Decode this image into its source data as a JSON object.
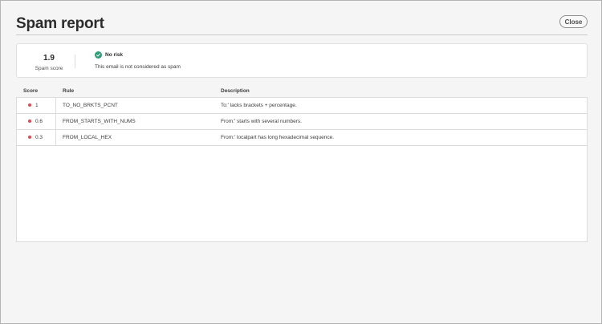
{
  "dialog": {
    "title": "Spam report",
    "close_label": "Close"
  },
  "summary": {
    "score": "1.9",
    "score_label": "Spam score",
    "risk_title": "No risk",
    "risk_description": "This email is not considered as spam",
    "risk_color": "#2d9d78"
  },
  "table": {
    "headers": {
      "score": "Score",
      "rule": "Rule",
      "description": "Description"
    },
    "rows": [
      {
        "score": "1",
        "rule": "TO_NO_BRKTS_PCNT",
        "description": "To:' lacks brackets + percentage.",
        "dot_color": "#e34850"
      },
      {
        "score": "0.6",
        "rule": "FROM_STARTS_WITH_NUMS",
        "description": "From:' starts with several numbers.",
        "dot_color": "#e34850"
      },
      {
        "score": "0.3",
        "rule": "FROM_LOCAL_HEX",
        "description": "From:' localpart has long hexadecimal sequence.",
        "dot_color": "#e34850"
      }
    ]
  }
}
